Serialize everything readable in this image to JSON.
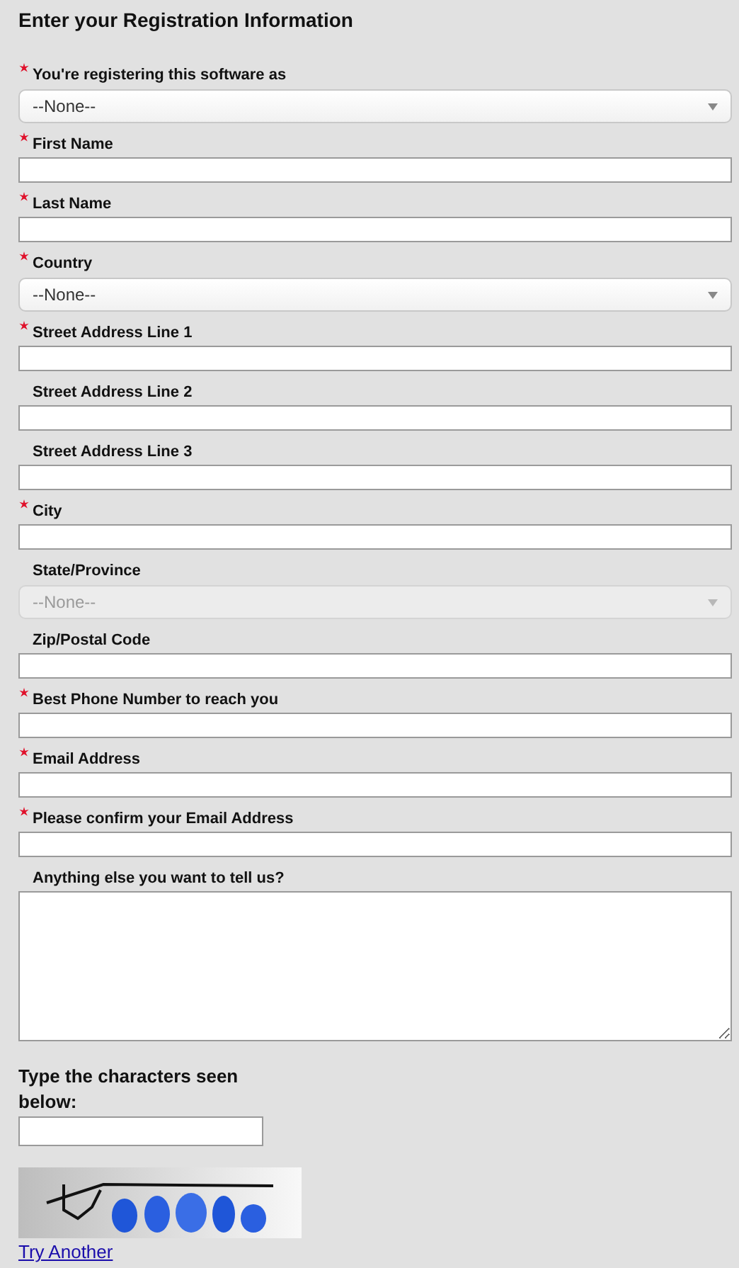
{
  "title": "Enter your Registration Information",
  "fields": [
    {
      "label": "You're registering this software as",
      "required": true,
      "kind": "select",
      "value": "--None--",
      "disabled": false
    },
    {
      "label": "First Name",
      "required": true,
      "kind": "text"
    },
    {
      "label": "Last Name",
      "required": true,
      "kind": "text"
    },
    {
      "label": "Country",
      "required": true,
      "kind": "select",
      "value": "--None--",
      "disabled": false
    },
    {
      "label": "Street Address Line 1",
      "required": true,
      "kind": "text"
    },
    {
      "label": "Street Address Line 2",
      "required": false,
      "kind": "text"
    },
    {
      "label": "Street Address Line 3",
      "required": false,
      "kind": "text"
    },
    {
      "label": "City",
      "required": true,
      "kind": "text"
    },
    {
      "label": "State/Province",
      "required": false,
      "kind": "select",
      "value": "--None--",
      "disabled": true
    },
    {
      "label": "Zip/Postal Code",
      "required": false,
      "kind": "text"
    },
    {
      "label": "Best Phone Number to reach you",
      "required": true,
      "kind": "text"
    },
    {
      "label": "Email Address",
      "required": true,
      "kind": "text"
    },
    {
      "label": "Please confirm your Email Address",
      "required": true,
      "kind": "text"
    },
    {
      "label": "Anything else you want to tell us?",
      "required": false,
      "kind": "textarea"
    }
  ],
  "captcha": {
    "label": "Type the characters seen below:",
    "link": "Try Another"
  }
}
